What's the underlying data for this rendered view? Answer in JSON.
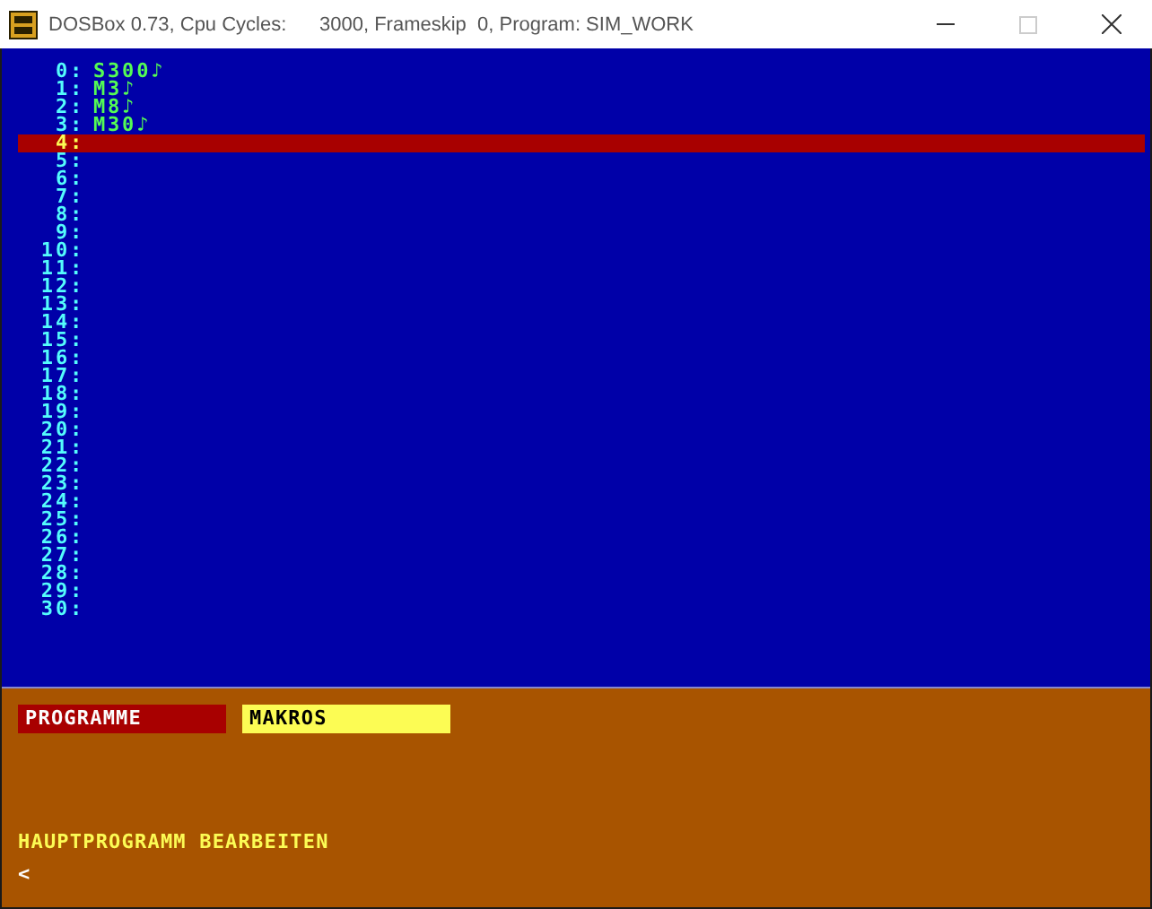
{
  "window": {
    "title": "DOSBox 0.73, Cpu Cycles:      3000, Frameskip  0, Program: SIM_WORK",
    "maximize_disabled": true
  },
  "lines": [
    {
      "number": "0:",
      "text": "S300♪",
      "selected": false
    },
    {
      "number": "1:",
      "text": "M3♪",
      "selected": false
    },
    {
      "number": "2:",
      "text": "M8♪",
      "selected": false
    },
    {
      "number": "3:",
      "text": "M30♪",
      "selected": false
    },
    {
      "number": "4:",
      "selected": true
    },
    {
      "number": "5:",
      "selected": false
    },
    {
      "number": "6:",
      "selected": false
    },
    {
      "number": "7:",
      "selected": false
    },
    {
      "number": "8:",
      "selected": false
    },
    {
      "number": "9:",
      "selected": false
    },
    {
      "number": "10:",
      "selected": false
    },
    {
      "number": "11:",
      "selected": false
    },
    {
      "number": "12:",
      "selected": false
    },
    {
      "number": "13:",
      "selected": false
    },
    {
      "number": "14:",
      "selected": false
    },
    {
      "number": "15:",
      "selected": false
    },
    {
      "number": "16:",
      "selected": false
    },
    {
      "number": "17:",
      "selected": false
    },
    {
      "number": "18:",
      "selected": false
    },
    {
      "number": "19:",
      "selected": false
    },
    {
      "number": "20:",
      "selected": false
    },
    {
      "number": "21:",
      "selected": false
    },
    {
      "number": "22:",
      "selected": false
    },
    {
      "number": "23:",
      "selected": false
    },
    {
      "number": "24:",
      "selected": false
    },
    {
      "number": "25:",
      "selected": false
    },
    {
      "number": "26:",
      "selected": false
    },
    {
      "number": "27:",
      "selected": false
    },
    {
      "number": "28:",
      "selected": false
    },
    {
      "number": "29:",
      "selected": false
    },
    {
      "number": "30:",
      "selected": false
    }
  ],
  "tabs": [
    {
      "label": "PROGRAMME",
      "selected": true
    },
    {
      "label": "MAKROS",
      "selected": false
    }
  ],
  "status": "HAUPTPROGRAMM BEARBEITEN",
  "prompt": "<"
}
